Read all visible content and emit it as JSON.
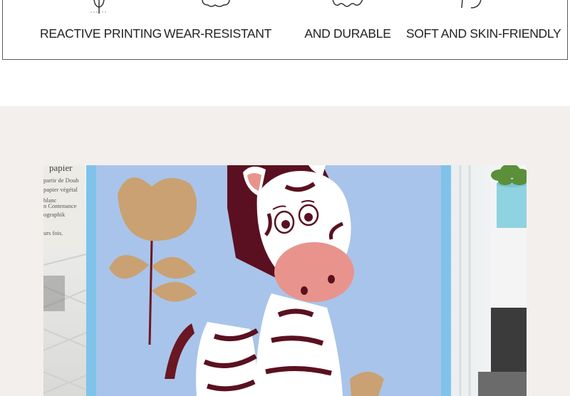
{
  "features": [
    {
      "label": "REACTIVE PRINTING",
      "icon": "tree-icon"
    },
    {
      "label": "WEAR-RESISTANT",
      "icon": "cloud-icon"
    },
    {
      "label": "AND DURABLE",
      "icon": "wave-icon"
    },
    {
      "label": "SOFT AND SKIN-FRIENDLY",
      "icon": "feather-icon"
    }
  ],
  "photo": {
    "subject": "zebra-blanket",
    "paper_text": [
      "papier",
      "partir de Doub",
      "papier végétal",
      "blanc",
      "n Contenance",
      "ographik",
      "urs fois."
    ]
  },
  "colors": {
    "section_bg": "#f3efec",
    "blanket_blue": "#a9c4ea",
    "blanket_border": "#7fc3ea",
    "zebra_dark": "#5a1020",
    "nose_pink": "#e8948d",
    "leaf_tan": "#c9a173"
  }
}
